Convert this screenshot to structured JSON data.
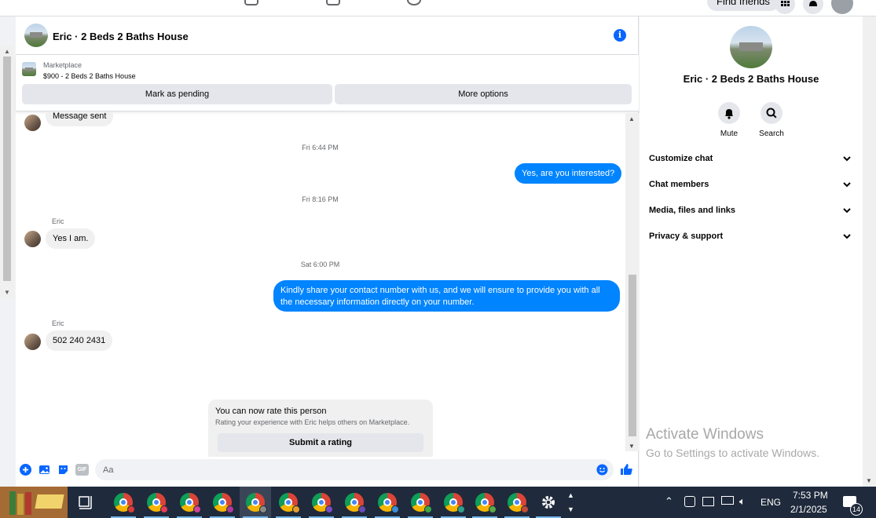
{
  "topnav": {
    "find_friends": "Find friends"
  },
  "chat": {
    "title": "Eric · 2 Beds 2 Baths House",
    "marketplace_label": "Marketplace",
    "marketplace_item": "$900 - 2 Beds 2 Baths House",
    "mark_pending": "Mark as pending",
    "more_options": "More options",
    "messages": [
      {
        "type": "incoming",
        "text": "Message sent"
      },
      {
        "type": "timestamp",
        "text": "Fri 6:44 PM"
      },
      {
        "type": "outgoing",
        "text": "Yes, are you interested?"
      },
      {
        "type": "timestamp",
        "text": "Fri 8:16 PM"
      },
      {
        "type": "sender",
        "text": "Eric"
      },
      {
        "type": "incoming",
        "text": "Yes I am."
      },
      {
        "type": "timestamp",
        "text": "Sat 6:00 PM"
      },
      {
        "type": "outgoing",
        "text": "Kindly share your contact number with us, and we will ensure to provide you with all the necessary information directly on your number."
      },
      {
        "type": "sender",
        "text": "Eric"
      },
      {
        "type": "incoming",
        "text": "502 240 2431"
      }
    ],
    "rating": {
      "title": "You can now rate this person",
      "subtitle": "Rating your experience with Eric helps others on Marketplace.",
      "button": "Submit a rating"
    },
    "composer": {
      "placeholder": "Aa",
      "gif_label": "GIF"
    }
  },
  "details": {
    "title": "Eric · 2 Beds 2 Baths House",
    "actions": [
      {
        "label": "Mute",
        "icon": "bell-icon"
      },
      {
        "label": "Search",
        "icon": "search-icon"
      }
    ],
    "sections": [
      {
        "label": "Customize chat"
      },
      {
        "label": "Chat members"
      },
      {
        "label": "Media, files and links"
      },
      {
        "label": "Privacy & support"
      }
    ]
  },
  "watermark": {
    "line1": "Activate Windows",
    "line2": "Go to Settings to activate Windows."
  },
  "taskbar": {
    "language": "ENG",
    "time": "7:53 PM",
    "date": "2/1/2025",
    "notifications": "14"
  },
  "colors": {
    "accent": "#0866ff",
    "outgoing_bubble": "#0084ff",
    "incoming_bubble": "#f0f0f0",
    "taskbar": "#1f2a3c"
  }
}
